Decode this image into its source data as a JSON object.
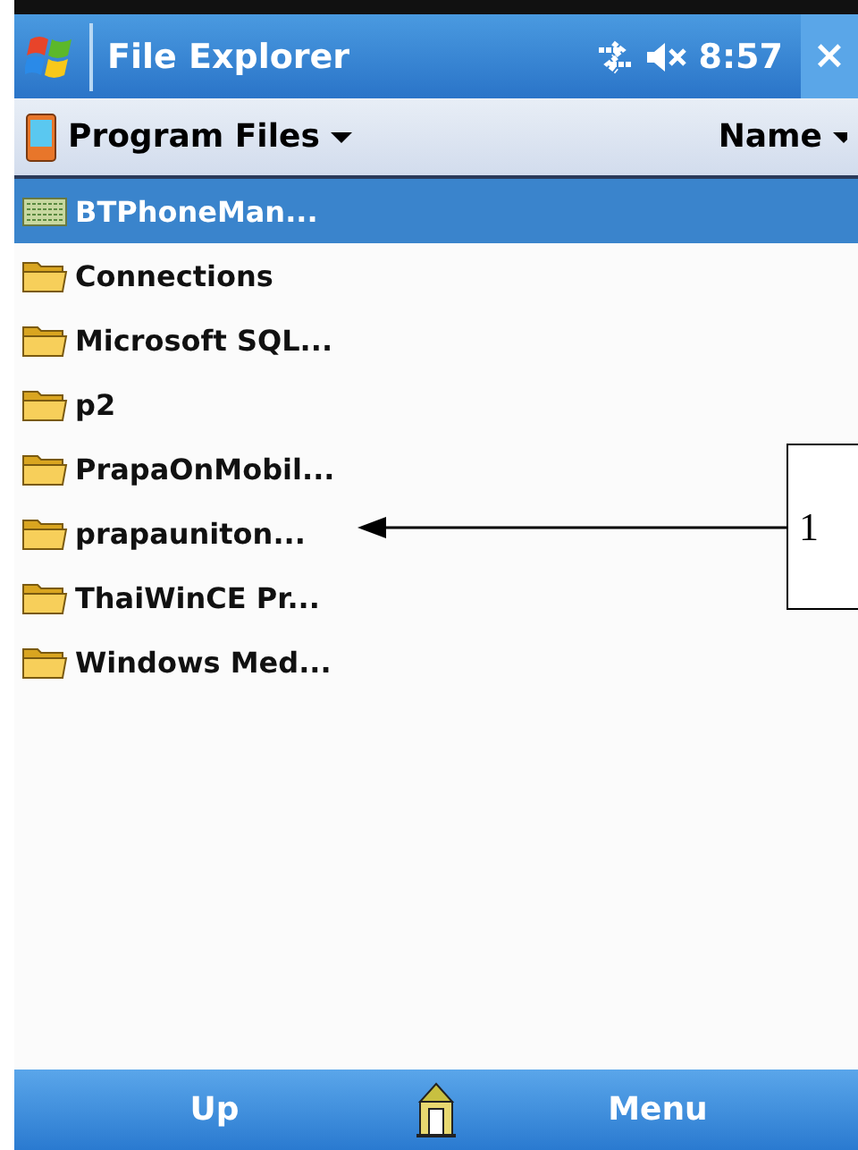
{
  "title_bar": {
    "title": "File Explorer",
    "time": "8:57",
    "close": "×"
  },
  "header": {
    "folder": "Program Files",
    "sort": "Name"
  },
  "items": [
    {
      "name": "BTPhoneMan...",
      "kind": "app",
      "selected": true
    },
    {
      "name": "Connections",
      "kind": "folder",
      "selected": false
    },
    {
      "name": "Microsoft SQL...",
      "kind": "folder",
      "selected": false
    },
    {
      "name": "p2",
      "kind": "folder",
      "selected": false
    },
    {
      "name": "PrapaOnMobil...",
      "kind": "folder",
      "selected": false
    },
    {
      "name": "prapauniton...",
      "kind": "folder",
      "selected": false
    },
    {
      "name": "ThaiWinCE Pr...",
      "kind": "folder",
      "selected": false
    },
    {
      "name": "Windows Med...",
      "kind": "folder",
      "selected": false
    }
  ],
  "callout": {
    "label": "1"
  },
  "soft_keys": {
    "left": "Up",
    "right": "Menu"
  }
}
